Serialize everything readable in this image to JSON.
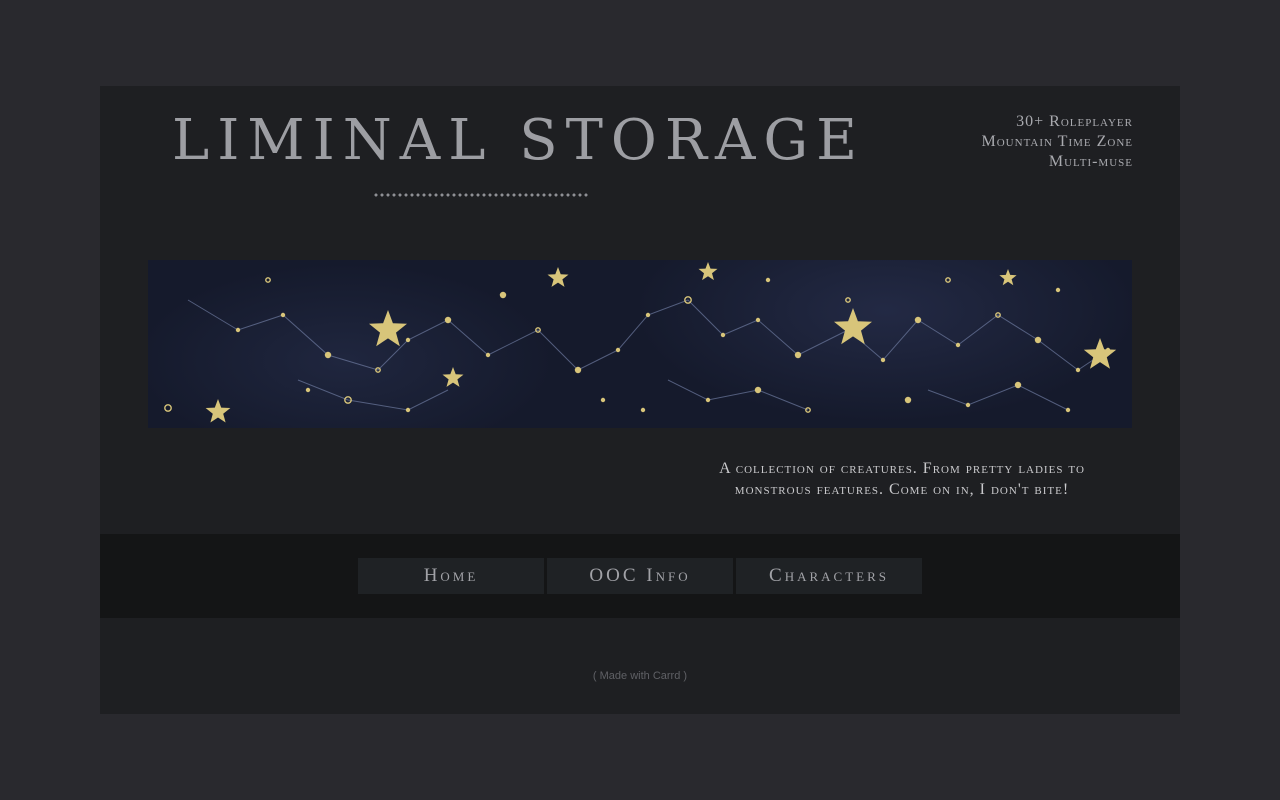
{
  "header": {
    "title": "Liminal Storage",
    "info_lines": [
      "30+ Roleplayer",
      "Mountain Time Zone",
      "Multi-muse"
    ]
  },
  "banner": {
    "description": "night sky constellation banner",
    "colors": {
      "sky": "#151a2c",
      "stars": "#d8c57a",
      "lines": "#6e7aa0"
    }
  },
  "tagline": "A collection of creatures. From pretty ladies to monstrous features. Come on in, I don't bite!",
  "nav": {
    "items": [
      {
        "label": "Home"
      },
      {
        "label": "OOC Info"
      },
      {
        "label": "Characters"
      }
    ]
  },
  "footer": {
    "credit": "( Made with Carrd )"
  },
  "colors": {
    "background": "#29292e",
    "card": "#1e1f22",
    "nav_band": "#141516",
    "nav_button": "#1f2225",
    "text": "#9d9ea3"
  }
}
